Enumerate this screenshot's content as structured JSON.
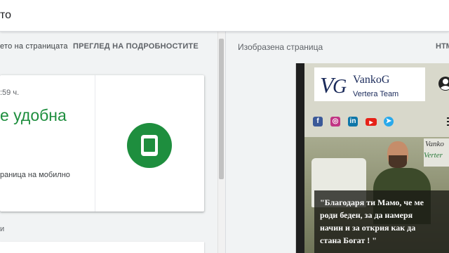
{
  "topbar": {
    "title": "то"
  },
  "left_panel": {
    "tabs": [
      {
        "label": "ето на страницата"
      },
      {
        "label": "ПРЕГЛЕД НА ПОДРОБНОСТИТЕ"
      }
    ],
    "card": {
      "time": ":59 ч.",
      "headline": "е удобна",
      "description": "раница на мобилно",
      "icon": "smartphone-icon"
    },
    "below_text": "и"
  },
  "right_panel": {
    "header_label": "Изобразена страница",
    "header_right": "HTM",
    "preview": {
      "logo_name": "VankoG",
      "logo_sub": "Vertera Team",
      "social_icons": [
        "facebook-icon",
        "instagram-icon",
        "linkedin-icon",
        "youtube-icon",
        "telegram-icon"
      ],
      "banner_line1": "Vanko",
      "banner_line2": "Verter",
      "quote": "\"Благодаря ти Мамо, че ме\nроди беден, за да намеря\nначин и за открия как да\nстана Богат ! \""
    }
  },
  "colors": {
    "green": "#1e8e3e",
    "pane_bg": "#f1f3f4"
  }
}
